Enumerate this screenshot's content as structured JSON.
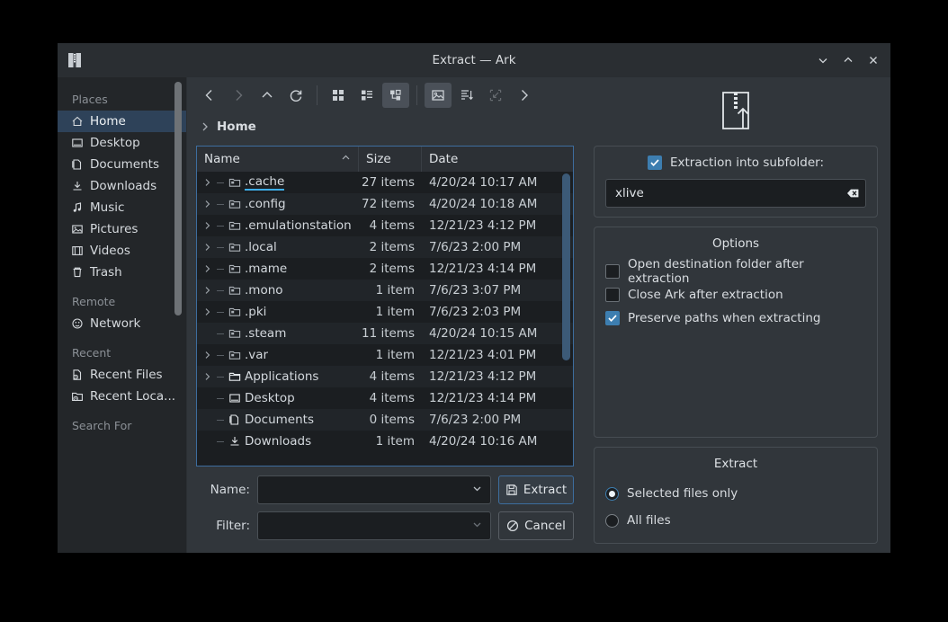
{
  "window": {
    "title": "Extract — Ark",
    "app_icon": "archive-zip-icon",
    "controls": {
      "minimize": "minimize-icon",
      "maximize": "maximize-icon",
      "close": "close-icon"
    }
  },
  "sidebar": {
    "groups": [
      {
        "label": "Places",
        "items": [
          {
            "label": "Home",
            "icon": "home-icon",
            "active": true
          },
          {
            "label": "Desktop",
            "icon": "desktop-icon",
            "active": false
          },
          {
            "label": "Documents",
            "icon": "documents-icon",
            "active": false
          },
          {
            "label": "Downloads",
            "icon": "downloads-icon",
            "active": false
          },
          {
            "label": "Music",
            "icon": "music-icon",
            "active": false
          },
          {
            "label": "Pictures",
            "icon": "pictures-icon",
            "active": false
          },
          {
            "label": "Videos",
            "icon": "videos-icon",
            "active": false
          },
          {
            "label": "Trash",
            "icon": "trash-icon",
            "active": false
          }
        ]
      },
      {
        "label": "Remote",
        "items": [
          {
            "label": "Network",
            "icon": "network-icon",
            "active": false
          }
        ]
      },
      {
        "label": "Recent",
        "items": [
          {
            "label": "Recent Files",
            "icon": "recent-files-icon",
            "active": false
          },
          {
            "label": "Recent Loca...",
            "icon": "recent-locations-icon",
            "active": false
          }
        ]
      },
      {
        "label": "Search For",
        "items": []
      }
    ]
  },
  "toolbar": {
    "back": "back-icon",
    "forward": "forward-icon",
    "up": "up-icon",
    "reload": "reload-icon",
    "icons_view": "icons-view-icon",
    "compact_view": "compact-view-icon",
    "detailed_view": "detailed-view-icon",
    "preview": "preview-icon",
    "sort": "sort-icon",
    "zoom_out": "zoom-out-icon",
    "overflow": "overflow-icon"
  },
  "breadcrumb": {
    "separator": "chevron-right-icon",
    "crumb": "Home"
  },
  "filelist": {
    "columns": [
      "Name",
      "Size",
      "Date"
    ],
    "sort_indicator": "sort-ascending-icon",
    "rows": [
      {
        "name": ".cache",
        "size": "27 items",
        "date": "4/20/24 10:17 AM",
        "icon": "folder-hidden-icon",
        "expandable": true,
        "current": true
      },
      {
        "name": ".config",
        "size": "72 items",
        "date": "4/20/24 10:18 AM",
        "icon": "folder-hidden-icon",
        "expandable": true,
        "current": false
      },
      {
        "name": ".emulationstation",
        "size": "4 items",
        "date": "12/21/23 4:12 PM",
        "icon": "folder-hidden-icon",
        "expandable": true,
        "current": false
      },
      {
        "name": ".local",
        "size": "2 items",
        "date": "7/6/23 2:00 PM",
        "icon": "folder-hidden-icon",
        "expandable": true,
        "current": false
      },
      {
        "name": ".mame",
        "size": "2 items",
        "date": "12/21/23 4:14 PM",
        "icon": "folder-hidden-icon",
        "expandable": true,
        "current": false
      },
      {
        "name": ".mono",
        "size": "1 item",
        "date": "7/6/23 3:07 PM",
        "icon": "folder-hidden-icon",
        "expandable": true,
        "current": false
      },
      {
        "name": ".pki",
        "size": "1 item",
        "date": "7/6/23 2:03 PM",
        "icon": "folder-hidden-icon",
        "expandable": true,
        "current": false
      },
      {
        "name": ".steam",
        "size": "11 items",
        "date": "4/20/24 10:15 AM",
        "icon": "folder-hidden-icon",
        "expandable": false,
        "current": false
      },
      {
        "name": ".var",
        "size": "1 item",
        "date": "12/21/23 4:01 PM",
        "icon": "folder-hidden-icon",
        "expandable": true,
        "current": false
      },
      {
        "name": "Applications",
        "size": "4 items",
        "date": "12/21/23 4:12 PM",
        "icon": "folder-icon",
        "expandable": true,
        "current": false
      },
      {
        "name": "Desktop",
        "size": "4 items",
        "date": "12/21/23 4:14 PM",
        "icon": "desktop-icon",
        "expandable": false,
        "current": false
      },
      {
        "name": "Documents",
        "size": "0 items",
        "date": "7/6/23 2:00 PM",
        "icon": "documents-icon",
        "expandable": false,
        "current": false
      },
      {
        "name": "Downloads",
        "size": "1 item",
        "date": "4/20/24 10:16 AM",
        "icon": "downloads-icon",
        "expandable": false,
        "current": false
      }
    ]
  },
  "form": {
    "name_label": "Name:",
    "name_value": "",
    "filter_label": "Filter:",
    "filter_value": "",
    "extract_button": "Extract",
    "extract_icon": "save-icon",
    "cancel_button": "Cancel",
    "cancel_icon": "cancel-icon"
  },
  "rightpanel": {
    "header_icon": "extract-archive-icon",
    "subfolder": {
      "label": "Extraction into subfolder:",
      "checked": true,
      "value": "xlive",
      "clear_icon": "clear-text-icon"
    },
    "options": {
      "title": "Options",
      "items": [
        {
          "label": "Open destination folder after extraction",
          "checked": false
        },
        {
          "label": "Close Ark after extraction",
          "checked": false
        },
        {
          "label": "Preserve paths when extracting",
          "checked": true
        }
      ]
    },
    "extract": {
      "title": "Extract",
      "options": [
        {
          "label": "Selected files only",
          "selected": true
        },
        {
          "label": "All files",
          "selected": false
        }
      ]
    }
  },
  "colors": {
    "accent": "#3daee9",
    "window_bg": "#31363b",
    "sidebar_bg": "#232629",
    "list_bg": "#1b1e21",
    "selection": "#2e4259",
    "checkbox_on": "#3d7eb0"
  }
}
